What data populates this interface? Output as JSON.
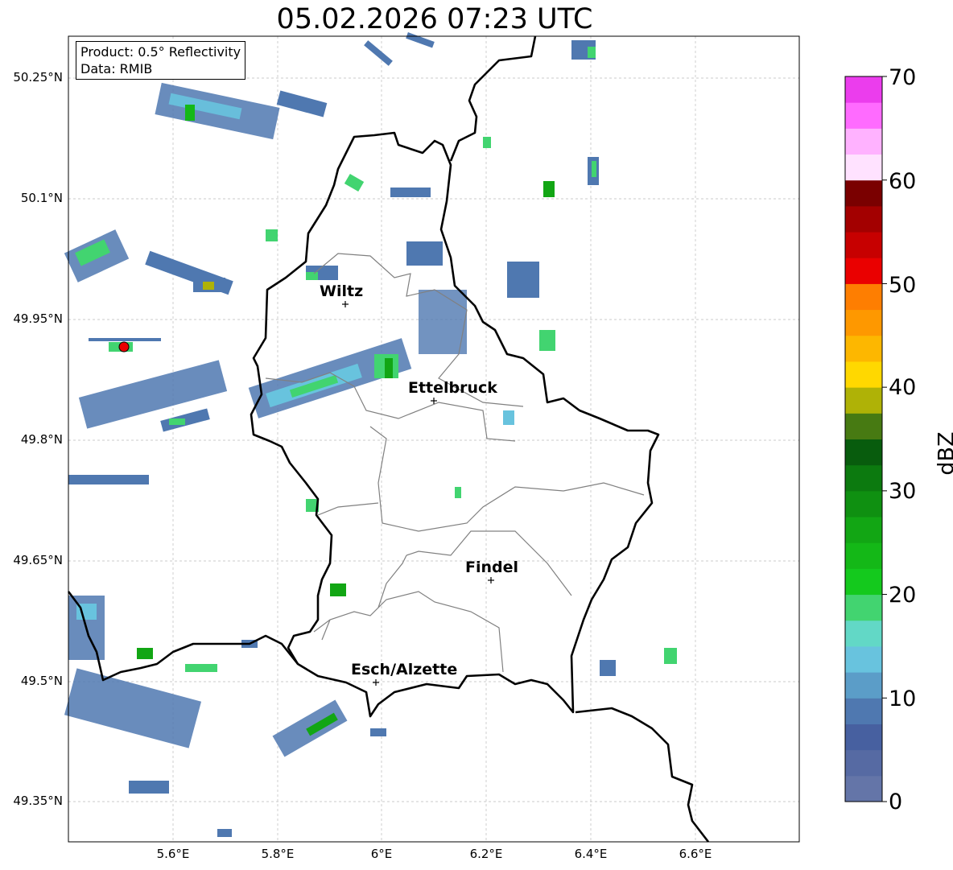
{
  "title": "05.02.2026 07:23 UTC",
  "info": {
    "product": "Product: 0.5° Reflectivity",
    "data": "Data: RMIB"
  },
  "axes": {
    "lat_ticks": [
      "50.25°N",
      "50.1°N",
      "49.95°N",
      "49.8°N",
      "49.65°N",
      "49.5°N",
      "49.35°N"
    ],
    "lon_ticks": [
      "5.6°E",
      "5.8°E",
      "6°E",
      "6.2°E",
      "6.4°E",
      "6.6°E"
    ]
  },
  "colorbar": {
    "label": "dBZ",
    "ticks": [
      "0",
      "10",
      "20",
      "30",
      "40",
      "50",
      "60",
      "70"
    ],
    "colors": [
      "#6475a8",
      "#566aa3",
      "#4760a0",
      "#4f78b0",
      "#5b9dc8",
      "#68c3de",
      "#62d8c6",
      "#42d470",
      "#14c91d",
      "#14b817",
      "#12a614",
      "#0f9011",
      "#0c7a0f",
      "#085c0d",
      "#477a12",
      "#afb206",
      "#ffd800",
      "#fdb700",
      "#fe9800",
      "#fe7e01",
      "#ea0000",
      "#c70000",
      "#a30000",
      "#7a0000",
      "#ffe2ff",
      "#ffb2ff",
      "#ff6bff",
      "#eb3ded"
    ]
  },
  "cities": [
    {
      "name": "Wiltz"
    },
    {
      "name": "Ettelbruck"
    },
    {
      "name": "Findel"
    },
    {
      "name": "Esch/Alzette"
    }
  ]
}
